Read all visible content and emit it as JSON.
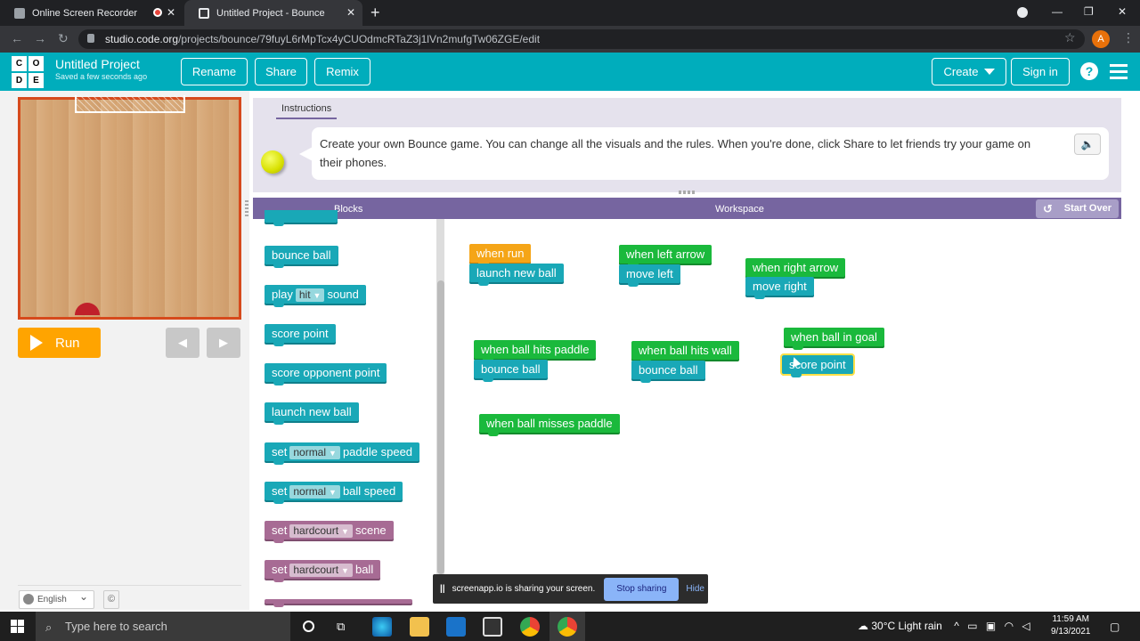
{
  "browser": {
    "tabs": [
      {
        "title": "Online Screen Recorder",
        "active": false
      },
      {
        "title": "Untitled Project - Bounce",
        "active": true
      }
    ],
    "url_domain": "studio.code.org",
    "url_path": "/projects/bounce/79fuyL6rMpTcx4yCUOdmcRTaZ3j1lVn2mufgTw06ZGE/edit",
    "profile_initial": "A"
  },
  "header": {
    "logo": [
      "C",
      "O",
      "D",
      "E"
    ],
    "project_title": "Untitled Project",
    "saved_status": "Saved a few seconds ago",
    "rename_label": "Rename",
    "share_label": "Share",
    "remix_label": "Remix",
    "create_label": "Create",
    "signin_label": "Sign in",
    "accent": "#00adbc"
  },
  "stage": {
    "run_label": "Run",
    "step_back": "◀",
    "step_forward": "▶"
  },
  "footer": {
    "language": "English",
    "copyright": "©"
  },
  "instructions": {
    "tab_label": "Instructions",
    "text": "Create your own Bounce game. You can change all the visuals and the rules. When you're done, click Share to let friends try your game on their phones."
  },
  "workspace": {
    "blocks_label": "Blocks",
    "workspace_label": "Workspace",
    "start_over_label": "Start Over"
  },
  "toolbox": {
    "bounce_ball": "bounce ball",
    "play_sound": {
      "prefix": "play",
      "value": "hit",
      "suffix": "sound"
    },
    "score_point": "score point",
    "score_opponent_point": "score opponent point",
    "launch_new_ball": "launch new ball",
    "set_paddle_speed": {
      "prefix": "set",
      "value": "normal",
      "suffix": "paddle speed"
    },
    "set_ball_speed": {
      "prefix": "set",
      "value": "normal",
      "suffix": "ball speed"
    },
    "set_scene": {
      "prefix": "set",
      "value": "hardcourt",
      "suffix": "scene"
    },
    "set_ball": {
      "prefix": "set",
      "value": "hardcourt",
      "suffix": "ball"
    }
  },
  "script_blocks": {
    "when_run": "when run",
    "launch_new_ball": "launch new ball",
    "when_left_arrow": "when left arrow",
    "move_left": "move left",
    "when_right_arrow": "when right arrow",
    "move_right": "move right",
    "when_ball_hits_paddle": "when ball hits paddle",
    "bounce_ball_1": "bounce ball",
    "when_ball_hits_wall": "when ball hits wall",
    "bounce_ball_2": "bounce ball",
    "when_ball_in_goal": "when ball in goal",
    "score_point": "score point",
    "when_ball_misses_paddle": "when ball misses paddle"
  },
  "share_banner": {
    "message": "screenapp.io is sharing your screen.",
    "stop_label": "Stop sharing",
    "hide_label": "Hide"
  },
  "taskbar": {
    "search_placeholder": "Type here to search",
    "weather": "30°C  Light rain",
    "time": "11:59 AM",
    "date": "9/13/2021"
  }
}
